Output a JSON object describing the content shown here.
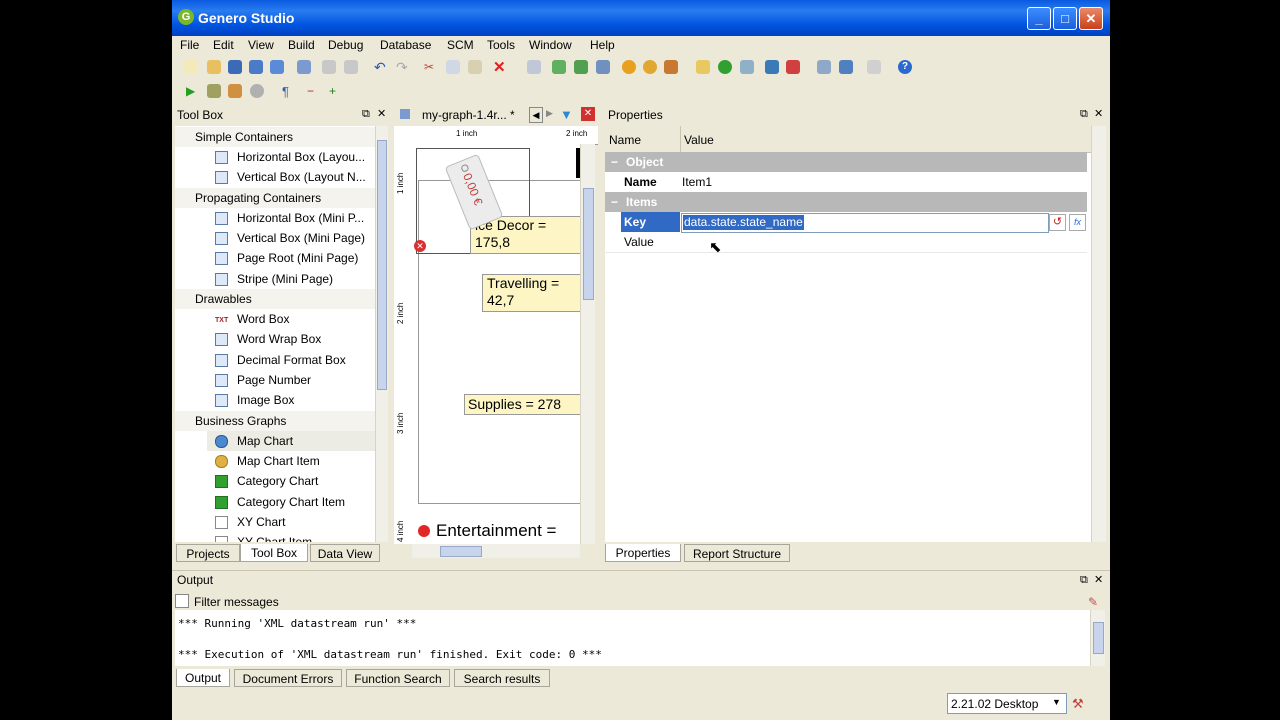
{
  "window": {
    "title": "Genero Studio"
  },
  "menu": [
    "File",
    "Edit",
    "View",
    "Build",
    "Debug",
    "Database",
    "SCM",
    "Tools",
    "Window",
    "Help"
  ],
  "toolbox": {
    "title": "Tool Box",
    "categories": [
      {
        "label": "Simple Containers",
        "items": [
          "Horizontal Box (Layou...",
          "Vertical Box (Layout N..."
        ]
      },
      {
        "label": "Propagating Containers",
        "items": [
          "Horizontal Box (Mini P...",
          "Vertical Box (Mini Page)",
          "Page Root (Mini Page)",
          "Stripe (Mini Page)"
        ]
      },
      {
        "label": "Drawables",
        "items": [
          "Word Box",
          "Word Wrap Box",
          "Decimal Format Box",
          "Page Number",
          "Image Box"
        ]
      },
      {
        "label": "Business Graphs",
        "items": [
          "Map Chart",
          "Map Chart Item",
          "Category Chart",
          "Category Chart Item",
          "XY Chart",
          "XY Chart Item"
        ]
      }
    ],
    "tabs": [
      "Projects",
      "Tool Box",
      "Data View"
    ]
  },
  "editor": {
    "tab_title": "my-graph-1.4r... *",
    "ruler": {
      "h1": "1 inch",
      "h2": "2 inch",
      "v1": "1 inch",
      "v2": "2 inch",
      "v3": "3 inch",
      "v4": "4 inch"
    },
    "tag_text": "0,00 €",
    "boxes": [
      "ice Decor =",
      "175,8",
      "Travelling =",
      "42,7",
      "Supplies = 278"
    ],
    "legend_text": "Entertainment ="
  },
  "properties": {
    "title": "Properties",
    "col_name": "Name",
    "col_value": "Value",
    "object_section": "Object",
    "name_label": "Name",
    "name_value": "Item1",
    "items_section": "Items",
    "key_label": "Key",
    "key_value": "data.state.state_name",
    "value_label": "Value",
    "tabs": [
      "Properties",
      "Report Structure"
    ]
  },
  "output": {
    "title": "Output",
    "filter_label": "Filter messages",
    "lines": [
      "*** Running 'XML datastream run' ***",
      "*** Execution of 'XML datastream run' finished. Exit code: 0 ***"
    ],
    "tabs": [
      "Output",
      "Document Errors",
      "Function Search",
      "Search results"
    ]
  },
  "status": {
    "profile": "2.21.02 Desktop"
  },
  "colors": {
    "titlebar": "#0a5ae0",
    "selection": "#316ac5",
    "sticky": "#fdf6c4"
  }
}
